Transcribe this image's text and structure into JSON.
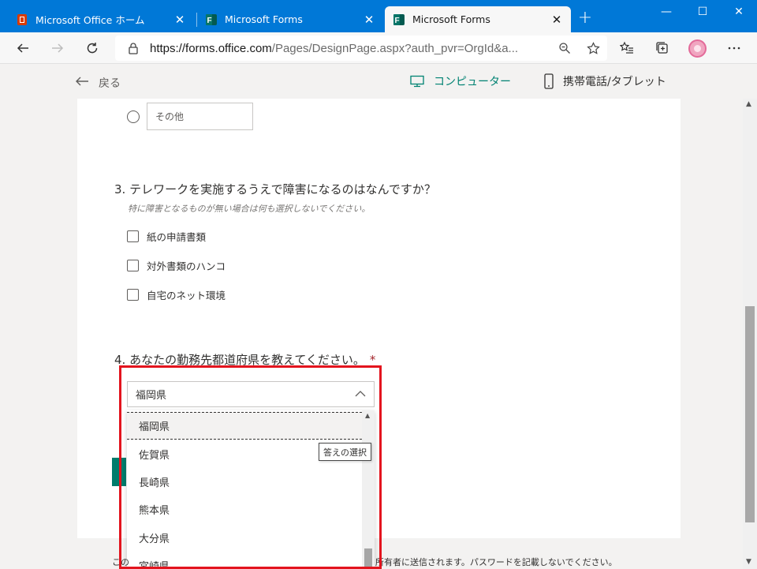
{
  "browser": {
    "tabs": [
      {
        "title": "Microsoft Office ホーム",
        "icon": "office-icon",
        "active": false
      },
      {
        "title": "Microsoft Forms",
        "icon": "forms-icon",
        "active": false
      },
      {
        "title": "Microsoft Forms",
        "icon": "forms-icon",
        "active": true
      }
    ],
    "new_tab": "+",
    "url_host": "https://forms.office.com",
    "url_path": "/Pages/DesignPage.aspx?auth_pvr=OrgId&a...",
    "controls": {
      "minimize": "—",
      "maximize": "☐",
      "close": "✕"
    }
  },
  "preview_bar": {
    "back_label": "戻る",
    "computer_label": "コンピューター",
    "mobile_label": "携帯電話/タブレット"
  },
  "form": {
    "other_placeholder": "その他",
    "q3": {
      "title": "3. テレワークを実施するうえで障害になるのはなんですか？",
      "subtitle": "特に障害となるものが無い場合は何も選択しないでください。",
      "options": [
        "紙の申請書類",
        "対外書類のハンコ",
        "自宅のネット環境"
      ]
    },
    "q4": {
      "title": "4. あなたの勤務先都道府県を教えてください。",
      "required_mark": "*",
      "selected": "福岡県",
      "options": [
        "福岡県",
        "佐賀県",
        "長崎県",
        "熊本県",
        "大分県",
        "宮崎県"
      ],
      "tooltip": "答えの選択"
    },
    "footer_left": "この",
    "footer_right": "所有者に送信されます。パスワードを記載しないでください。"
  },
  "colors": {
    "browser_blue": "#0078d7",
    "forms_teal": "#008272",
    "highlight_red": "#e3141e",
    "required_red": "#a4262c"
  }
}
